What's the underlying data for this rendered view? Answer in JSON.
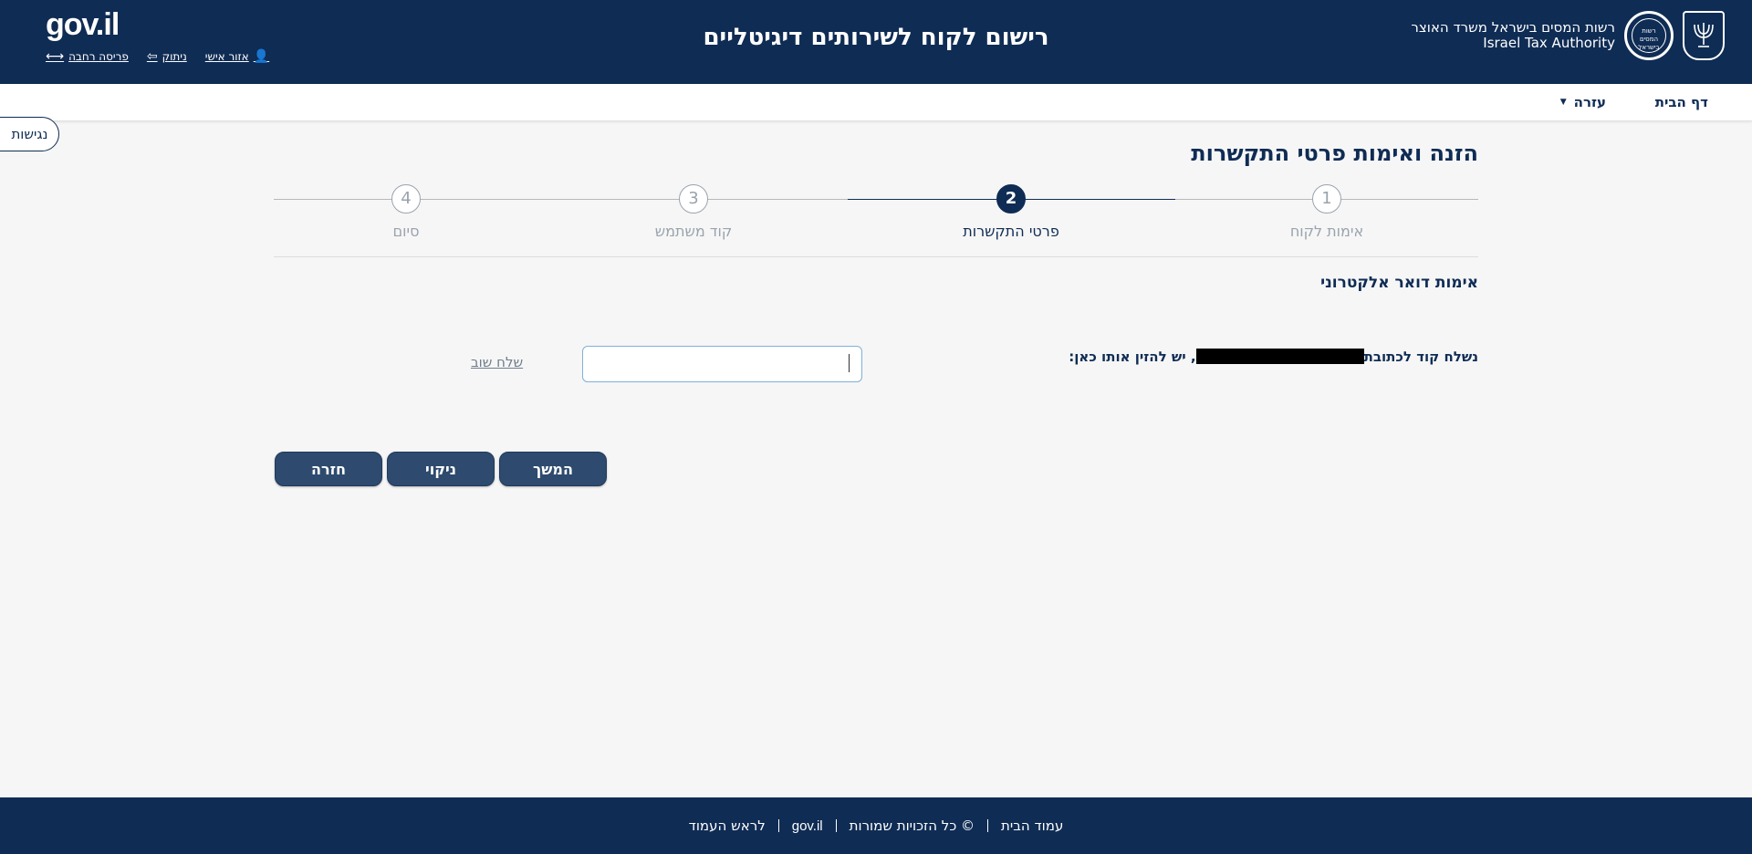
{
  "header": {
    "title": "רישום לקוח לשירותים דיגיטליים",
    "org_he": "רשות המסים בישראל משרד האוצר",
    "org_en": "Israel Tax Authority",
    "emblem_text": "רשות המסים בישראל",
    "gov_logo": "gov.il",
    "links": {
      "personal_area": "אזור אישי",
      "logout": "ניתוק",
      "wide_layout": "פריסה רחבה"
    }
  },
  "nav": {
    "home": "דף הבית",
    "help": "עזרה"
  },
  "accessibility": "נגישות",
  "main": {
    "title": "הזנה ואימות פרטי התקשרות",
    "steps": [
      {
        "num": "1",
        "label": "אימות לקוח"
      },
      {
        "num": "2",
        "label": "פרטי התקשרות"
      },
      {
        "num": "3",
        "label": "קוד משתמש"
      },
      {
        "num": "4",
        "label": "סיום"
      }
    ],
    "active_step": 2,
    "section_title": "אימות דואר אלקטרוני",
    "code_prompt_start": "נשלח קוד לכתובת",
    "code_prompt_end": ", יש להזין אותו כאן:",
    "code_input_value": "",
    "resend": "שלח שוב",
    "buttons": {
      "continue": "המשך",
      "clear": "ניקוי",
      "back": "חזרה"
    }
  },
  "footer": {
    "home": "עמוד הבית",
    "rights": "© כל הזכויות שמורות",
    "logo": "gov.il",
    "top": "לראש העמוד"
  }
}
